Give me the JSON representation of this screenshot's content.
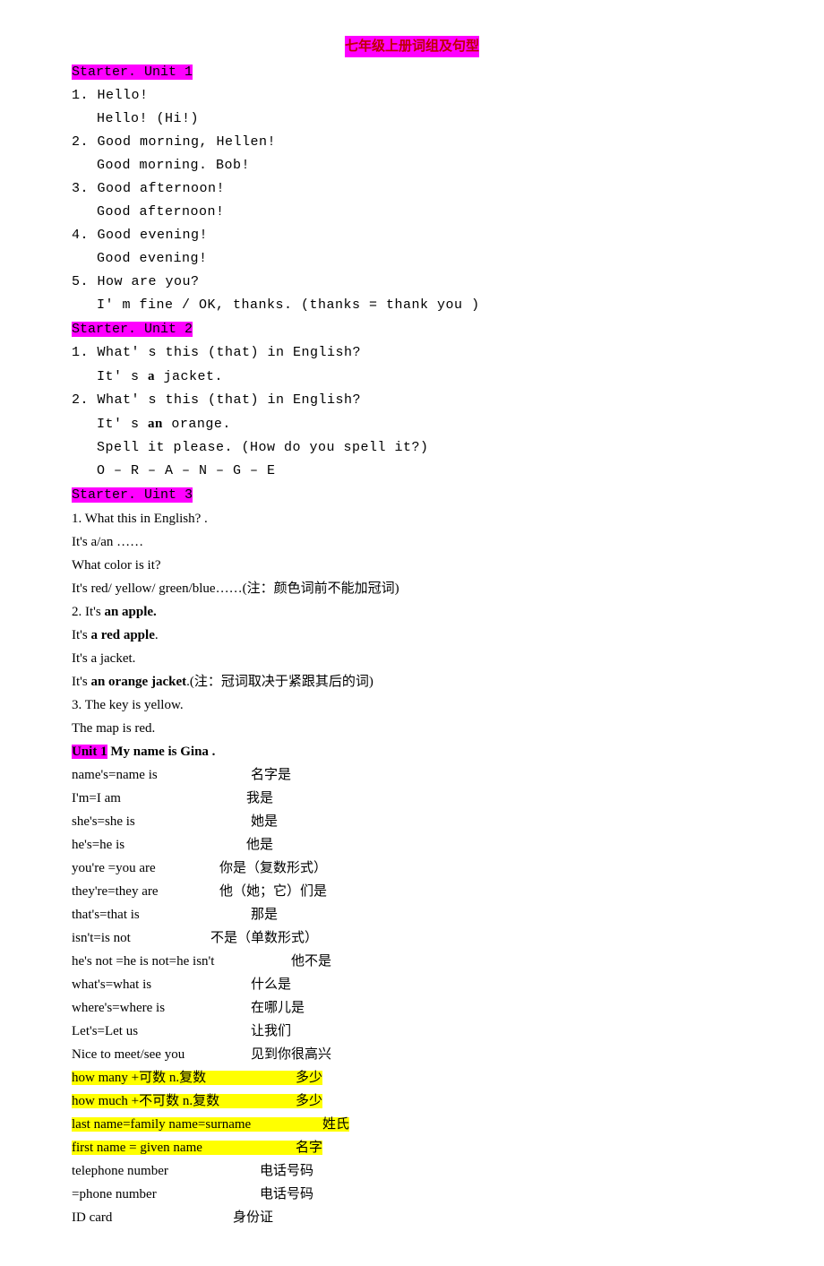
{
  "title": "七年级上册词组及句型",
  "starter1": {
    "heading": "Starter. Unit 1",
    "lines": [
      "1. Hello!",
      "Hello! (Hi!)",
      "2. Good morning, Hellen!",
      "Good morning. Bob!",
      "3. Good afternoon!",
      "Good afternoon!",
      "4. Good evening!",
      "Good evening!",
      "5. How are you?",
      "I' m fine / OK,  thanks.  (thanks = thank you )"
    ]
  },
  "starter2": {
    "heading": "Starter. Unit 2",
    "l1": "1. What' s this (that) in English?",
    "l2a": "It' s ",
    "l2b": "a",
    "l2c": " jacket.",
    "l3": "2. What' s this (that) in English?",
    "l4a": "It' s ",
    "l4b": "an",
    "l4c": " orange.",
    "l5": "Spell it please.  (How do you spell it?)",
    "l6": "O – R – A – N – G – E"
  },
  "starter3": {
    "heading": "Starter. Uint 3",
    "l1": "1. What this in English? .",
    "l2": "It's a/an ……",
    "l3": "What color is it?",
    "l4": "It's red/ yellow/ green/blue……(注：颜色词前不能加冠词)",
    "l5a": "2. It's ",
    "l5b": "an apple.",
    "l6a": "It's ",
    "l6b": "a red apple",
    "l6c": ".",
    "l7": "It's a jacket.",
    "l8a": "It's ",
    "l8b": "an orange jacket",
    "l8c": ".(注：冠词取决于紧跟其后的词)",
    "l9": "3. The key is yellow.",
    "l10": "The map is red."
  },
  "unit1": {
    "heading": "Unit 1",
    "subtitle": "  My name is Gina .",
    "vocab": [
      {
        "l": "name's=name is",
        "r": "名字是"
      },
      {
        "l": "I'm=I am",
        "r": "我是"
      },
      {
        "l": "she's=she is",
        "r": "她是"
      },
      {
        "l": "he's=he is",
        "r": "他是"
      },
      {
        "l": "you're =you are",
        "r": "你是（复数形式）"
      },
      {
        "l": "they're=they are",
        "r": "他（她；它）们是"
      },
      {
        "l": "that's=that is",
        "r": "那是"
      },
      {
        "l": "isn't=is not",
        "r": "不是（单数形式）"
      },
      {
        "l": "he's not =he is not=he isn't",
        "r": "他不是"
      },
      {
        "l": "what's=what is",
        "r": "什么是"
      },
      {
        "l": "where's=where is",
        "r": "在哪儿是"
      },
      {
        "l": "Let's=Let us",
        "r": "让我们"
      },
      {
        "l": "Nice to meet/see you",
        "r": "见到你很高兴"
      }
    ],
    "yellow": [
      {
        "l": "how many +可数 n.复数",
        "r": "多少"
      },
      {
        "l": "how much +不可数 n.复数",
        "r": "多少"
      },
      {
        "l": "last name=family name=surname",
        "r": "姓氏"
      },
      {
        "l": "first name = given name",
        "r": "名字"
      }
    ],
    "vocab2": [
      {
        "l": "telephone number",
        "r": "电话号码"
      },
      {
        "l": "=phone number",
        "r": "电话号码"
      },
      {
        "l": "ID card",
        "r": "身份证"
      }
    ]
  }
}
